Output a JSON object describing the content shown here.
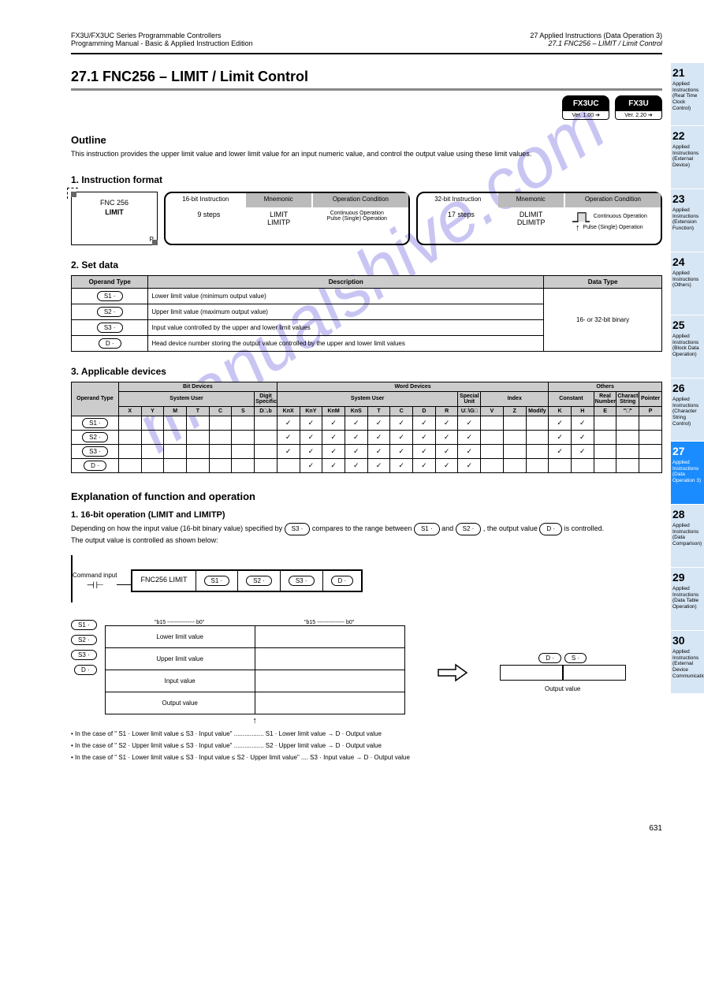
{
  "top": {
    "left_line1": "FX3U/FX3UC Series Programmable Controllers",
    "left_line2": "Programming Manual - Basic & Applied Instruction Edition",
    "right_line1": "27 Applied Instructions (Data Operation 3)",
    "right_line2": "27.1 FNC256 – LIMIT / Limit Control"
  },
  "section": "27.1    FNC256 – LIMIT / Limit Control",
  "badges": {
    "b1": "FX3UC",
    "b1_ver": "Ver. 1.00 ➔",
    "b2": "FX3U",
    "b2_ver": "Ver. 2.20 ➔"
  },
  "outline": {
    "head": "Outline",
    "text": "This instruction provides the upper limit value and lower limit value for an input numeric value, and control the output value using these limit values."
  },
  "format": {
    "head": "1. Instruction format",
    "fnc_no": "FNC 256",
    "fnc_name": "LIMIT",
    "fnc_p": "P",
    "box1": {
      "h1": "16-bit Instruction",
      "h2": "Mnemonic",
      "h3": "Operation Condition",
      "steps": "9 steps",
      "m1": "LIMIT",
      "c1": "Continuous Operation",
      "m2": "LIMITP",
      "c2": "Pulse (Single) Operation"
    },
    "box2": {
      "h1": "32-bit Instruction",
      "h2": "Mnemonic",
      "h3": "Operation Condition",
      "steps": "17 steps",
      "m1": "DLIMIT",
      "c1": "Continuous Operation",
      "m2": "DLIMITP",
      "c2": "Pulse (Single) Operation"
    }
  },
  "operands": {
    "head": "2. Set data",
    "headers": [
      "Operand Type",
      "Description",
      "Data Type"
    ],
    "rows": [
      {
        "op": "S1 ·",
        "desc": "Lower limit value (minimum output value)",
        "type": "16- or 32-bit binary"
      },
      {
        "op": "S2 ·",
        "desc": "Upper limit value (maximum output value)",
        "type": "16- or 32-bit binary"
      },
      {
        "op": "S3 ·",
        "desc": "Input value controlled by the upper and lower limit values",
        "type": "16- or 32-bit binary"
      },
      {
        "op": "D ·",
        "desc": "Head device number storing the output value controlled by the upper and lower limit values",
        "type": "16- or 32-bit binary"
      }
    ]
  },
  "devices": {
    "head": "3. Applicable devices",
    "top_headers": [
      "Operand Type",
      "Bit Devices",
      "Word Devices",
      "Others"
    ],
    "sub_headers_bit": [
      "System User",
      "Digit Specification"
    ],
    "sub_headers_word": [
      "System User",
      "Special Unit",
      "Index"
    ],
    "sub_headers_others": [
      "Constant",
      "Real Number",
      "Character String",
      "Pointer"
    ],
    "cols": [
      "X",
      "Y",
      "M",
      "T",
      "C",
      "S",
      "D□.b",
      "KnX",
      "KnY",
      "KnM",
      "KnS",
      "T",
      "C",
      "D",
      "R",
      "U□\\G□",
      "V",
      "Z",
      "Modify",
      "K",
      "H",
      "E",
      "\"□\"",
      "P"
    ],
    "rows": [
      {
        "op": "S1 ·",
        "checks": {
          "KnX": 1,
          "KnY": 1,
          "KnM": 1,
          "KnS": 1,
          "T": 1,
          "C": 1,
          "D": 1,
          "R": 1,
          "UG": 1,
          "K": 1,
          "H": 1
        }
      },
      {
        "op": "S2 ·",
        "checks": {
          "KnX": 1,
          "KnY": 1,
          "KnM": 1,
          "KnS": 1,
          "T": 1,
          "C": 1,
          "D": 1,
          "R": 1,
          "UG": 1,
          "K": 1,
          "H": 1
        }
      },
      {
        "op": "S3 ·",
        "checks": {
          "KnX": 1,
          "KnY": 1,
          "KnM": 1,
          "KnS": 1,
          "T": 1,
          "C": 1,
          "D": 1,
          "R": 1,
          "UG": 1,
          "K": 1,
          "H": 1
        }
      },
      {
        "op": "D ·",
        "checks": {
          "KnY": 1,
          "KnM": 1,
          "KnS": 1,
          "T": 1,
          "C": 1,
          "D": 1,
          "R": 1,
          "UG": 1
        }
      }
    ]
  },
  "func": {
    "title": "Explanation of function and operation",
    "sub": "1. 16-bit operation (LIMIT and LIMITP)",
    "text_a": "Depending on how the input value (16-bit binary value) specified by ",
    "s3": "S3 ·",
    "text_b": " compares to the range between ",
    "s1": "S1 ·",
    "and": " and ",
    "s2": "S2 ·",
    "text_c": ", the output value ",
    "d": "D ·",
    "text_d": " is controlled.",
    "text_e": "The output value is controlled as shown below:",
    "ladder": {
      "cmd": "Command input",
      "inst": "FNC256 LIMIT",
      "p1": "S1 ·",
      "p2": "S2 ·",
      "p3": "S3 ·",
      "p4": "D ·"
    },
    "mem": {
      "labels": [
        "S1 ·",
        "S2 ·",
        "S3 ·",
        "D ·"
      ],
      "hdr_left": "\"b15 --------------- b0\"",
      "hdr_right": "\"b15 --------------- b0\"",
      "rows": [
        [
          "Lower limit value",
          ""
        ],
        [
          "Upper limit value",
          ""
        ],
        [
          "Input value",
          ""
        ],
        [
          "Output value",
          ""
        ]
      ],
      "out_lbl_l": "D ·",
      "out_lbl_r": "S ·",
      "brace": "Output value",
      "arrow_note": "↑",
      "note": "• In the case of \" S1 ·  Lower limit value ≤  S3 ·  Input value\" ................. S1 ·  Lower limit value →  D ·  Output value"
    }
  },
  "footline1": "• In the case of \"  S2 ·  Upper limit value ≤  S3 ·  Input value\" ................. S2 ·  Upper limit value →  D ·  Output value",
  "footline2": "• In the case of \"  S1 ·  Lower limit value ≤  S3 ·  Input value ≤  S2 ·  Upper limit value\" ....  S3 ·  Input value →  D ·  Output value",
  "footer": {
    "page": "631"
  },
  "tabs": [
    {
      "n": "21",
      "t": "Applied Instructions (Real Time Clock Control)"
    },
    {
      "n": "22",
      "t": "Applied Instructions (External Device)"
    },
    {
      "n": "23",
      "t": "Applied Instructions (Extension Function)"
    },
    {
      "n": "24",
      "t": "Applied Instructions (Others)"
    },
    {
      "n": "25",
      "t": "Applied Instructions (Block Data Operation)"
    },
    {
      "n": "26",
      "t": "Applied Instructions (Character String Control)"
    },
    {
      "n": "27",
      "t": "Applied Instructions (Data Operation 3)",
      "active": true
    },
    {
      "n": "28",
      "t": "Applied Instructions (Data Comparison)"
    },
    {
      "n": "29",
      "t": "Applied Instructions (Data Table Operation)"
    },
    {
      "n": "30",
      "t": "Applied Instructions (External Device Communication)"
    }
  ],
  "watermark": "manualshive.com"
}
